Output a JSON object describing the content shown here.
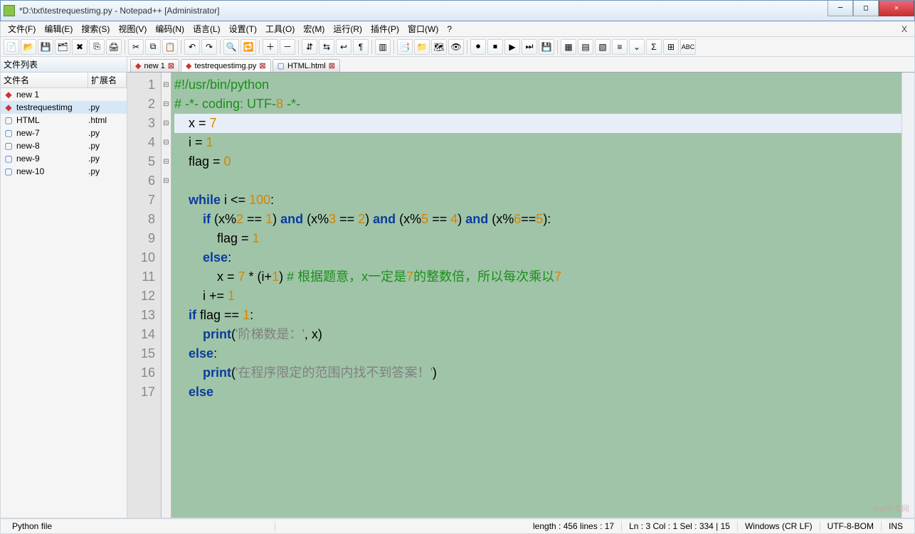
{
  "window": {
    "title": "*D:\\txt\\testrequestimg.py - Notepad++ [Administrator]"
  },
  "menu": [
    "文件(F)",
    "编辑(E)",
    "搜索(S)",
    "视图(V)",
    "编码(N)",
    "语言(L)",
    "设置(T)",
    "工具(O)",
    "宏(M)",
    "运行(R)",
    "插件(P)",
    "窗口(W)",
    "?"
  ],
  "sidebar": {
    "title": "文件列表",
    "cols": {
      "name": "文件名",
      "ext": "扩展名"
    },
    "items": [
      {
        "name": "new 1",
        "ext": "",
        "dirty": true,
        "sel": false
      },
      {
        "name": "testrequestimg",
        "ext": ".py",
        "dirty": true,
        "sel": true
      },
      {
        "name": "HTML",
        "ext": ".html",
        "dirty": false,
        "sel": false
      },
      {
        "name": "new-7",
        "ext": ".py",
        "dirty": false,
        "sel": false
      },
      {
        "name": "new-8",
        "ext": ".py",
        "dirty": false,
        "sel": false
      },
      {
        "name": "new-9",
        "ext": ".py",
        "dirty": false,
        "sel": false
      },
      {
        "name": "new-10",
        "ext": ".py",
        "dirty": false,
        "sel": false
      }
    ]
  },
  "tabs": [
    {
      "label": "new 1",
      "dirty": true,
      "active": false
    },
    {
      "label": "testrequestimg.py",
      "dirty": true,
      "active": true
    },
    {
      "label": "HTML.html",
      "dirty": false,
      "active": false
    }
  ],
  "code": {
    "lines": [
      "#!/usr/bin/python",
      "# -*- coding: UTF-8 -*-",
      "    x = 7",
      "    i = 1",
      "    flag = 0",
      "",
      "    while i <= 100:",
      "        if (x%2 == 1) and (x%3 == 2) and (x%5 == 4) and (x%6==5):",
      "            flag = 1",
      "        else:",
      "            x = 7 * (i+1) # 根据题意，x一定是7的整数倍，所以每次乘以7",
      "        i += 1",
      "    if flag == 1:",
      "        print('阶梯数是：', x)",
      "    else:",
      "        print('在程序限定的范围内找不到答案！')",
      "    else"
    ],
    "fold": [
      "⊟",
      "",
      "",
      "",
      "",
      "",
      "⊟",
      "⊟",
      "",
      "⊟",
      "",
      "",
      "⊟",
      "",
      "⊟",
      "",
      ""
    ],
    "current_line": 3
  },
  "status": {
    "lang": "Python file",
    "length": "length : 456    lines : 17",
    "pos": "Ln : 3    Col : 1    Sel : 334 | 15",
    "eol": "Windows (CR LF)",
    "enc": "UTF-8-BOM",
    "mode": "INS"
  },
  "watermark": "php中文网"
}
